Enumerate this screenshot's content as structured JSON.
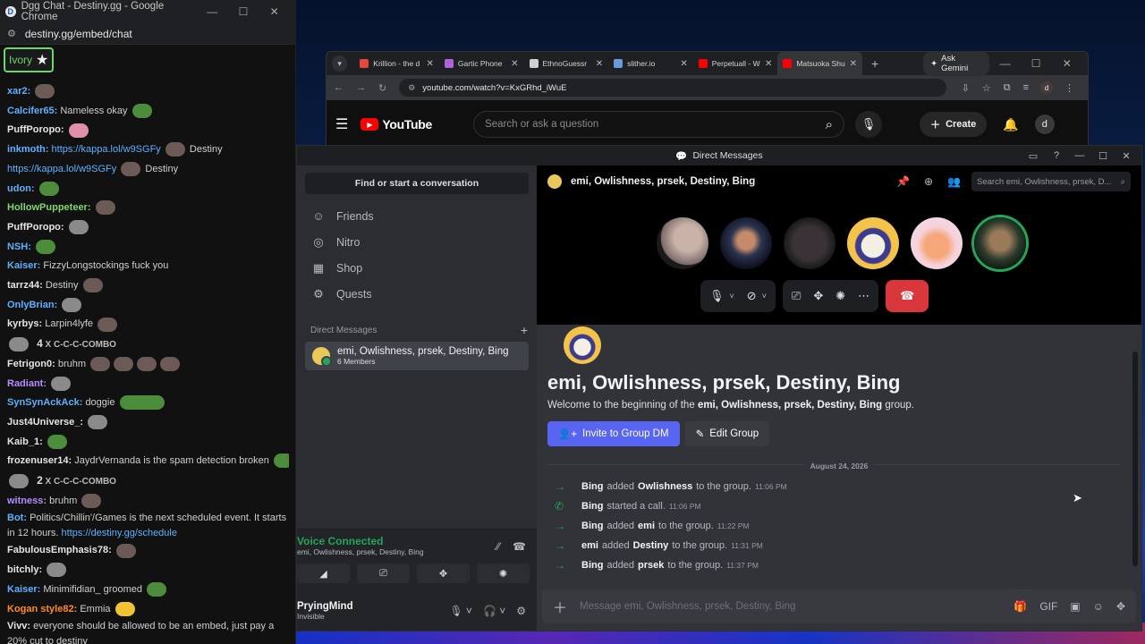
{
  "left_chat": {
    "window_title": "Dgg Chat - Destiny.gg - Google Chrome",
    "url": "destiny.gg/embed/chat",
    "user_badge": "Ivory",
    "lines": [
      {
        "nick": "xar2:",
        "text": ""
      },
      {
        "nick": "Calcifer65:",
        "text": "Nameless okay"
      },
      {
        "nick": "PuffPoropo:",
        "text": ""
      },
      {
        "nick": "inkmoth:",
        "link": "https://kappa.lol/w9SGFy",
        "text": "Destiny"
      },
      {
        "nick": "",
        "link": "https://kappa.lol/w9SGFy",
        "text": "Destiny"
      },
      {
        "nick": "udon:",
        "text": ""
      },
      {
        "nick": "HollowPuppeteer:",
        "text": ""
      },
      {
        "nick": "PuffPoropo:",
        "text": ""
      },
      {
        "nick": "NSH:",
        "text": ""
      },
      {
        "nick": "Kaiser:",
        "text": "FizzyLongstockings fuck you"
      },
      {
        "nick": "tarrz44:",
        "text": "Destiny"
      },
      {
        "nick": "OnlyBrian:",
        "text": ""
      },
      {
        "nick": "kyrbys:",
        "text": "Larpin4lyfe"
      },
      {
        "nick": "",
        "text": "",
        "combo": "4",
        "combo_label": "X C-C-C-COMBO"
      },
      {
        "nick": "Fetrigon0:",
        "text": "bruhm"
      },
      {
        "nick": "Radiant:",
        "text": ""
      },
      {
        "nick": "SynSynAckAck:",
        "text": "doggie"
      },
      {
        "nick": "Just4Universe_:",
        "text": ""
      },
      {
        "nick": "Kaib_1:",
        "text": ""
      },
      {
        "nick": "frozenuser14:",
        "text": "JaydrVernanda is the spam detection broken"
      },
      {
        "nick": "",
        "text": "",
        "combo": "2",
        "combo_label": "X C-C-C-COMBO"
      },
      {
        "nick": "witness:",
        "text": "bruhm"
      },
      {
        "nick": "Bot:",
        "text": "Politics/Chillin'/Games is the next scheduled event. It starts in 12 hours.",
        "link": "https://destiny.gg/schedule"
      },
      {
        "nick": "FabulousEmphasis78:",
        "text": ""
      },
      {
        "nick": "bitchly:",
        "text": ""
      },
      {
        "nick": "Kaiser:",
        "text": "Minimifidian_ groomed"
      },
      {
        "nick": "Kogan style82:",
        "text": "Emmia"
      },
      {
        "nick": "Vivv:",
        "text": "everyone should be allowed to be an embed, just pay a 20% cut to destiny"
      }
    ]
  },
  "browser": {
    "tabs": [
      {
        "label": "Krillion - the d",
        "color": "#e04a3a"
      },
      {
        "label": "Gartic Phone",
        "color": "#b062d8"
      },
      {
        "label": "EthnoGuessr",
        "color": "#d0d0d0"
      },
      {
        "label": "slither.io",
        "color": "#6a9ad8"
      },
      {
        "label": "Perpetuall - W",
        "color": "#ff0000"
      },
      {
        "label": "Matsuoka Shu",
        "color": "#ff0000"
      }
    ],
    "gemini_label": "Ask Gemini",
    "url": "youtube.com/watch?v=KxGRhd_iWuE",
    "profile_initial": "d",
    "youtube": {
      "logo_text": "YouTube",
      "search_placeholder": "Search or ask a question",
      "create_label": "Create",
      "avatar_initial": "d"
    }
  },
  "discord": {
    "window_title": "Direct Messages",
    "find_conversation": "Find or start a conversation",
    "nav": [
      {
        "label": "Friends",
        "icon": "friends-icon"
      },
      {
        "label": "Nitro",
        "icon": "nitro-icon"
      },
      {
        "label": "Shop",
        "icon": "shop-icon"
      },
      {
        "label": "Quests",
        "icon": "quests-icon"
      }
    ],
    "dm_header": "Direct Messages",
    "dm_entry": {
      "name": "emi, Owlishness, prsek, Destiny, Bing",
      "sub": "6 Members"
    },
    "voice": {
      "status": "Voice Connected",
      "channel": "emi, Owlishness, prsek, Destiny, Bing"
    },
    "user": {
      "name": "PryingMind",
      "status": "Invisible"
    },
    "call_header_title": "emi, Owlishness, prsek, Destiny, Bing",
    "search_placeholder": "Search emi, Owlishness, prsek, D...",
    "group_title": "emi, Owlishness, prsek, Destiny, Bing",
    "welcome_prefix": "Welcome to the beginning of the",
    "welcome_group": "emi, Owlishness, prsek, Destiny, Bing",
    "welcome_suffix": "group.",
    "invite_label": "Invite to Group DM",
    "edit_label": "Edit Group",
    "date": "August 24, 2026",
    "messages": [
      {
        "who": "Bing",
        "verb": "added",
        "target": "Owlishness",
        "rest": "to the group.",
        "time": "11:06 PM",
        "icon": "arrow"
      },
      {
        "who": "Bing",
        "verb": "started a call.",
        "target": "",
        "rest": "",
        "time": "11:06 PM",
        "icon": "phone"
      },
      {
        "who": "Bing",
        "verb": "added",
        "target": "emi",
        "rest": "to the group.",
        "time": "11:22 PM",
        "icon": "arrow"
      },
      {
        "who": "emi",
        "verb": "added",
        "target": "Destiny",
        "rest": "to the group.",
        "time": "11:31 PM",
        "icon": "arrow"
      },
      {
        "who": "Bing",
        "verb": "added",
        "target": "prsek",
        "rest": "to the group.",
        "time": "11:37 PM",
        "icon": "arrow"
      }
    ],
    "composer_placeholder": "Message emi, Owlishness, prsek, Destiny, Bing"
  }
}
